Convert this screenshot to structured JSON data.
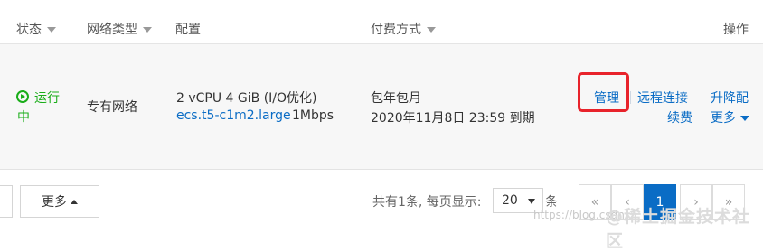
{
  "header": {
    "status": "状态",
    "network_type": "网络类型",
    "config": "配置",
    "payment": "付费方式",
    "actions": "操作"
  },
  "row": {
    "status_line1": "运行",
    "status_line2": "中",
    "network": "专有网络",
    "config_spec": "2 vCPU 4 GiB  (I/O优化)",
    "instance_type": "ecs.t5-c1m2.large",
    "bandwidth": "1Mbps",
    "billing": "包年包月",
    "expire": "2020年11月8日 23:59 到期",
    "actions": {
      "manage": "管理",
      "remote": "远程连接",
      "upgrade": "升降配",
      "renew": "续费",
      "more": "更多"
    }
  },
  "footer": {
    "more_button": "更多",
    "summary": "共有1条, 每页显示:",
    "page_size": "20",
    "page_unit": "条",
    "pages": {
      "first": "«",
      "prev": "‹",
      "current": "1",
      "next": "›",
      "last": "»"
    }
  },
  "watermark": {
    "url": "https://blog.csdn",
    "brand": "@稀土掘金技术社区"
  },
  "colors": {
    "link": "#0a6cc5",
    "running": "#1aad19",
    "highlight": "#e8232b",
    "active_page": "#0a6cc5"
  }
}
